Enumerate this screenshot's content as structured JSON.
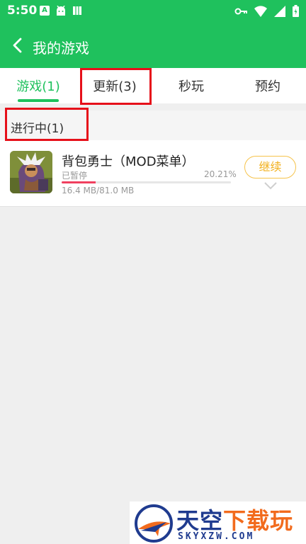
{
  "status_bar": {
    "time": "5:50",
    "left_icons": [
      "a-icon",
      "android-icon",
      "book-icon"
    ],
    "right_icons": [
      "key-icon",
      "wifi-icon",
      "signal-icon",
      "battery-icon"
    ]
  },
  "app_bar": {
    "title": "我的游戏"
  },
  "tabs": [
    {
      "label": "游戏(1)",
      "active": true
    },
    {
      "label": "更新(3)",
      "active": false
    },
    {
      "label": "秒玩",
      "active": false
    },
    {
      "label": "预约",
      "active": false
    }
  ],
  "section": {
    "title": "进行中(1)"
  },
  "downloads": [
    {
      "name": "背包勇士（MOD菜单）",
      "status": "已暂停",
      "percent_label": "20.21%",
      "progress": 0.2021,
      "size": "16.4 MB/81.0 MB",
      "action_label": "继续"
    }
  ],
  "colors": {
    "primary_green": "#1fc15d",
    "progress_red": "#f0405f",
    "action_orange": "#f2b01c",
    "highlight_red": "#e6101a"
  },
  "watermark": {
    "cn_part1": "天空",
    "cn_part2": "下载玩",
    "en": "SKYXZW.COM"
  }
}
